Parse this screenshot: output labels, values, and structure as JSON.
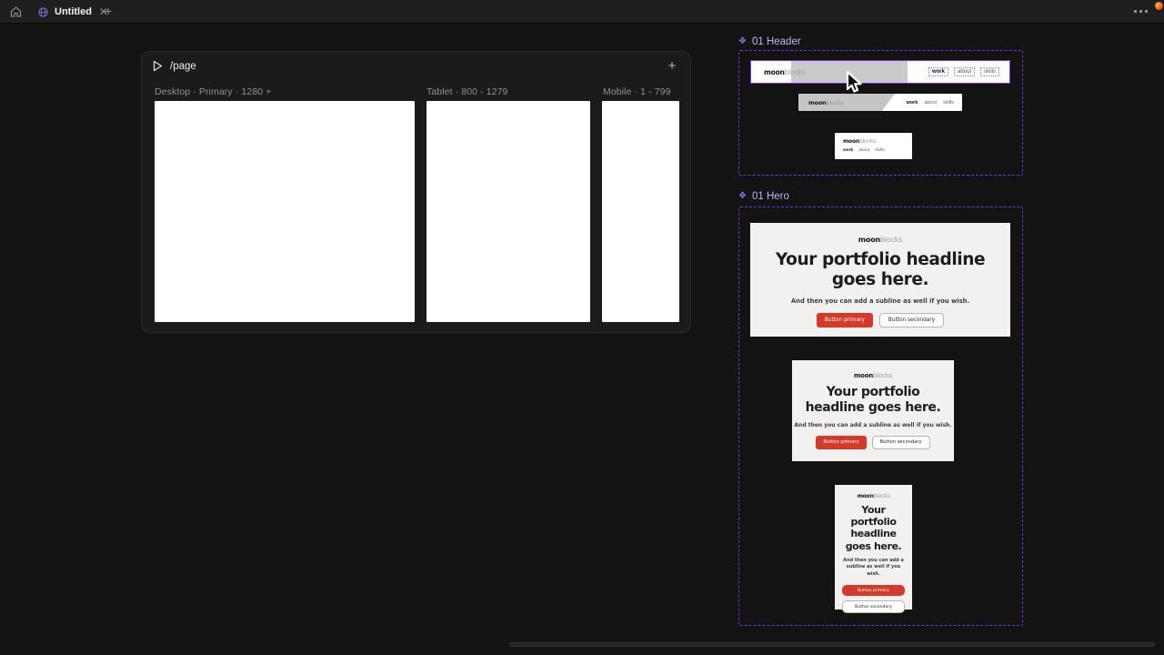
{
  "topbar": {
    "tab_title": "Untitled",
    "close_label": "✕",
    "new_tab_label": "+"
  },
  "page_panel": {
    "title": "/page",
    "add_label": "+",
    "breakpoints": [
      {
        "label": "Desktop · Primary · 1280 +"
      },
      {
        "label": "Tablet · 800 - 1279"
      },
      {
        "label": "Mobile · 1 - 799"
      }
    ]
  },
  "sections": [
    {
      "label": "01 Header",
      "icon": "❖"
    },
    {
      "label": "01 Hero",
      "icon": "❖"
    }
  ],
  "brand": {
    "logo_bold": "moon",
    "logo_light": "blocks"
  },
  "nav": {
    "items": [
      "work",
      "about",
      "skills"
    ]
  },
  "hero": {
    "headline": "Your portfolio headline goes here.",
    "subline": "And then you can add a subline as well if you wish.",
    "btn_primary": "Button primary",
    "btn_secondary": "Button secondary"
  },
  "colors": {
    "accent_purple": "#7d2ae8",
    "primary_red": "#d23b2a",
    "canvas_bg": "#131313",
    "panel_bg": "#1b1b1b",
    "hero_bg": "#f2f1ef"
  }
}
